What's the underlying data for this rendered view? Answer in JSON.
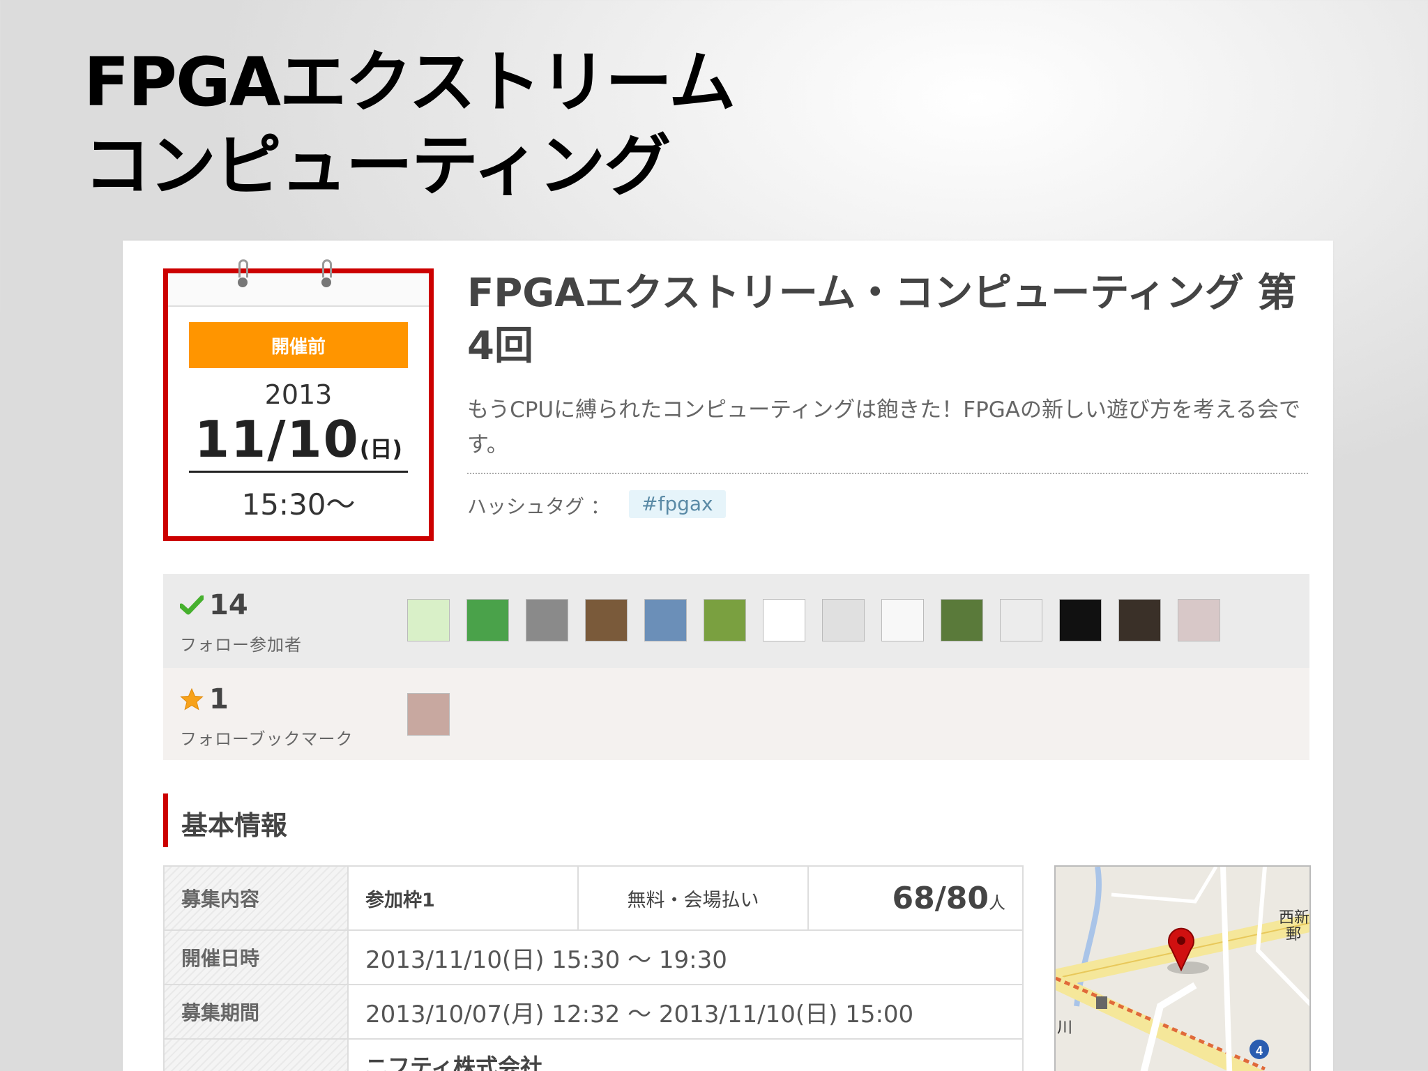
{
  "slide": {
    "title_line1": "FPGAエクストリーム",
    "title_line2": "コンピューティング"
  },
  "calendar": {
    "status": "開催前",
    "year": "2013",
    "date": "11/10",
    "weekday": "(日)",
    "start_time": "15:30〜"
  },
  "event": {
    "title": "FPGAエクストリーム・コンピューティング 第4回",
    "description": "もうCPUに縛られたコンピューティングは飽きた！FPGAの新しい遊び方を考える会です。",
    "hashtag_label": "ハッシュタグ ：",
    "hashtag": "#fpgax"
  },
  "participants": {
    "count": "14",
    "label": "フォロー参加者",
    "icon": "checkmark-icon",
    "avatars": [
      {
        "color": "#d9f0c8"
      },
      {
        "color": "#4aa24a"
      },
      {
        "color": "#8a8a8a"
      },
      {
        "color": "#7a5a3a"
      },
      {
        "color": "#6b8fb8"
      },
      {
        "color": "#7aa040"
      },
      {
        "color": "#ffffff"
      },
      {
        "color": "#e0e0e0"
      },
      {
        "color": "#f8f8f8"
      },
      {
        "color": "#5a7a3a"
      },
      {
        "color": "#ececec"
      },
      {
        "color": "#111111"
      },
      {
        "color": "#3a3028"
      },
      {
        "color": "#d8c8c8"
      }
    ]
  },
  "bookmarks": {
    "count": "1",
    "label": "フォローブックマーク",
    "icon": "star-icon",
    "avatars": [
      {
        "color": "#c8a8a0"
      }
    ]
  },
  "section": {
    "title": "基本情報"
  },
  "info": {
    "recruit_label": "募集内容",
    "frame": "参加枠1",
    "fee": "無料・会場払い",
    "capacity": "68/80",
    "capacity_unit": "人",
    "datetime_label": "開催日時",
    "datetime": "2013/11/10(日) 15:30 〜 19:30",
    "period_label": "募集期間",
    "period": "2013/10/07(月) 12:32 〜 2013/11/10(日) 15:00",
    "organizer": "ニフティ株式会社"
  },
  "map": {
    "label_1": "西新",
    "label_2": "郵",
    "label_3": "川",
    "route_badge": "4",
    "pin_color": "#d01010"
  }
}
